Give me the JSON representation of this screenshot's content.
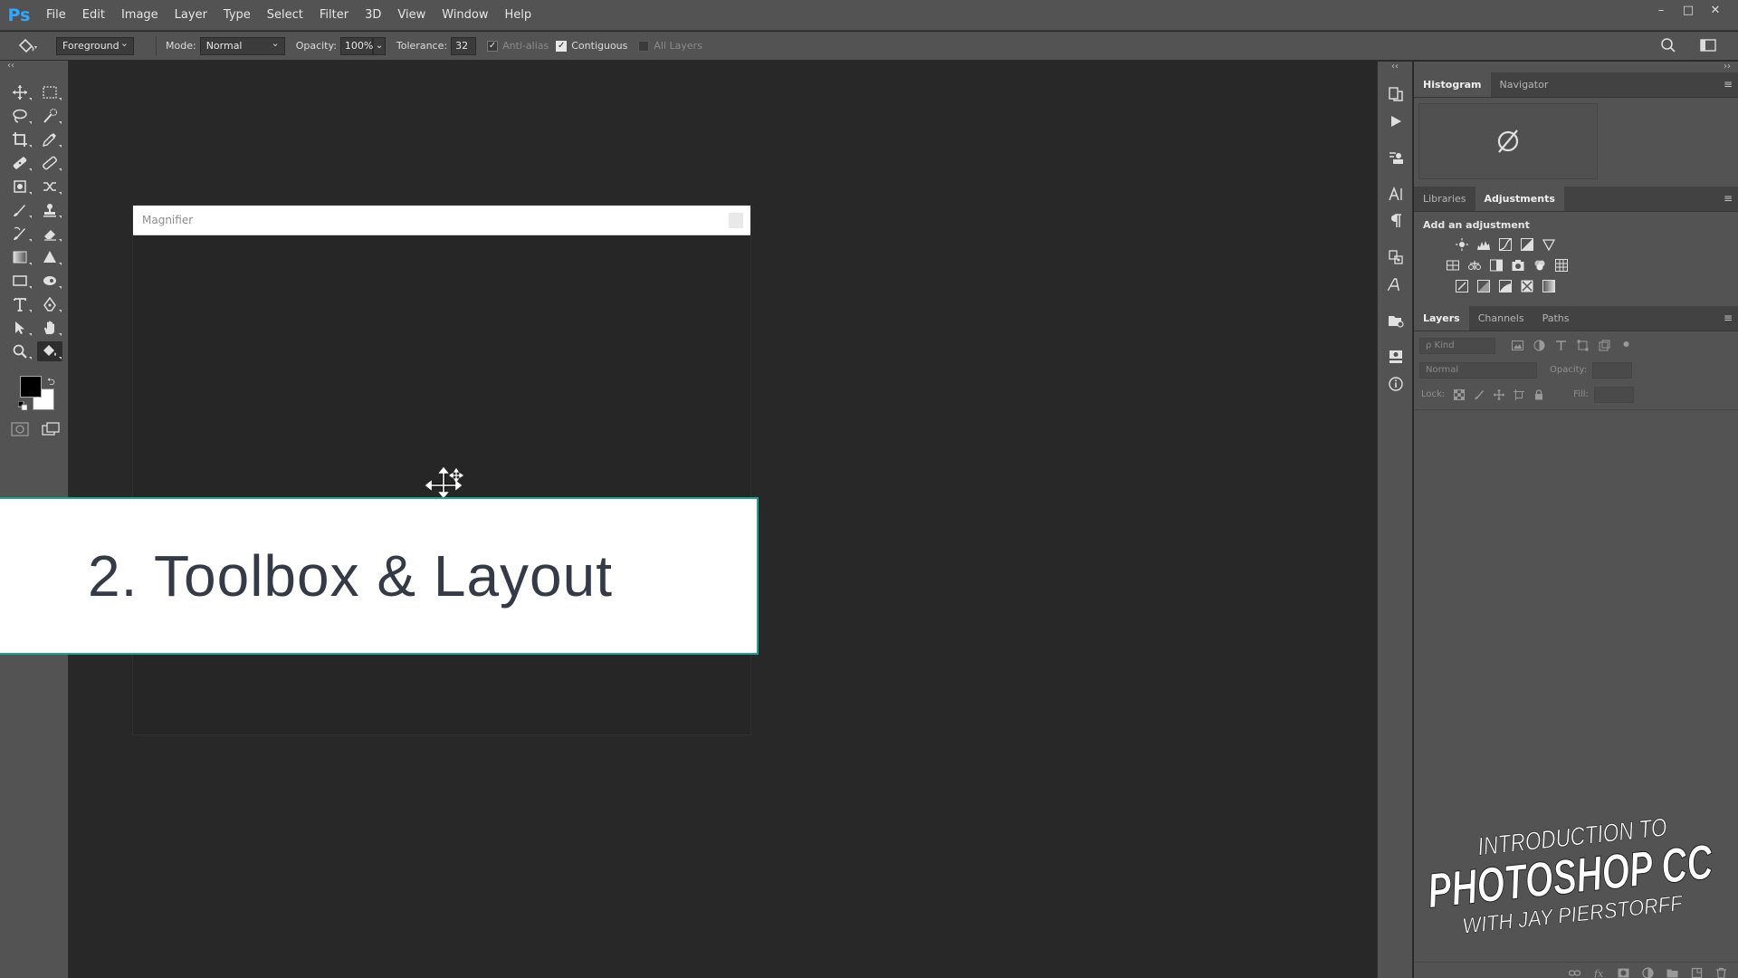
{
  "app": {
    "logo": "Ps"
  },
  "menu": [
    "File",
    "Edit",
    "Image",
    "Layer",
    "Type",
    "Select",
    "Filter",
    "3D",
    "View",
    "Window",
    "Help"
  ],
  "window_controls": {
    "minimize": "–",
    "maximize": "□",
    "close": "✕"
  },
  "options_bar": {
    "fill_source": "Foreground",
    "mode_label": "Mode:",
    "mode_value": "Normal",
    "opacity_label": "Opacity:",
    "opacity_value": "100%",
    "tolerance_label": "Tolerance:",
    "tolerance_value": "32",
    "anti_alias_label": "Anti-alias",
    "contiguous_label": "Contiguous",
    "all_layers_label": "All Layers"
  },
  "toolbar": {
    "collapse": "‹‹"
  },
  "magnifier": {
    "title": "Magnifier"
  },
  "title_card": {
    "text": "2. Toolbox & Layout"
  },
  "dock": {
    "collapse": "‹‹"
  },
  "panels": {
    "collapse": "››",
    "top_group": {
      "tabs": [
        "Histogram",
        "Navigator"
      ],
      "active": 0
    },
    "mid_group": {
      "tabs": [
        "Libraries",
        "Adjustments"
      ],
      "active": 1,
      "add_adjustment": "Add an adjustment"
    },
    "layers_group": {
      "tabs": [
        "Layers",
        "Channels",
        "Paths"
      ],
      "active": 0,
      "kind_placeholder": "ρ Kind",
      "blend_mode": "Normal",
      "opacity_label": "Opacity:",
      "lock_label": "Lock:",
      "fill_label": "Fill:"
    },
    "menu_glyph": "≡"
  },
  "course_logo": {
    "line1": "INTRODUCTION TO",
    "line2": "PHOTOSHOP CC",
    "line3": "WITH JAY PIERSTORFF"
  },
  "colors": {
    "foreground": "#000000",
    "background": "#ffffff",
    "accent": "#1fa38a",
    "ps_blue": "#31a8ff"
  }
}
